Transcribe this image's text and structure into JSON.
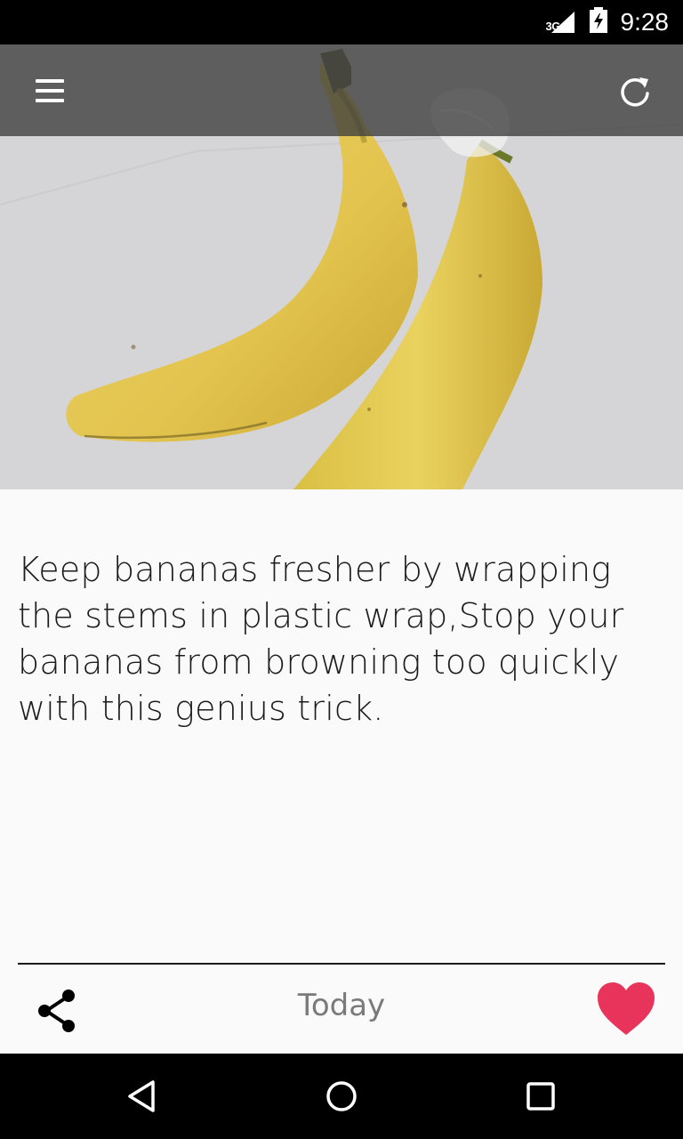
{
  "status_bar": {
    "network_type": "3G",
    "time": "9:28",
    "icons": [
      "signal-icon",
      "battery-icon"
    ]
  },
  "app_bar": {
    "menu_icon": "menu-icon",
    "refresh_icon": "refresh-icon"
  },
  "hero": {
    "image_subject": "two bananas with stems wrapped in plastic"
  },
  "tip": {
    "text": "Keep bananas fresher by wrapping the stems in plastic wrap,Stop your bananas from browning too quickly with this genius trick."
  },
  "footer": {
    "share_icon": "share-icon",
    "label": "Today",
    "favorite_icon": "heart-icon",
    "favorite_color": "#e8345a"
  },
  "nav_bar": {
    "icons": [
      "back-icon",
      "home-icon",
      "recents-icon"
    ]
  }
}
